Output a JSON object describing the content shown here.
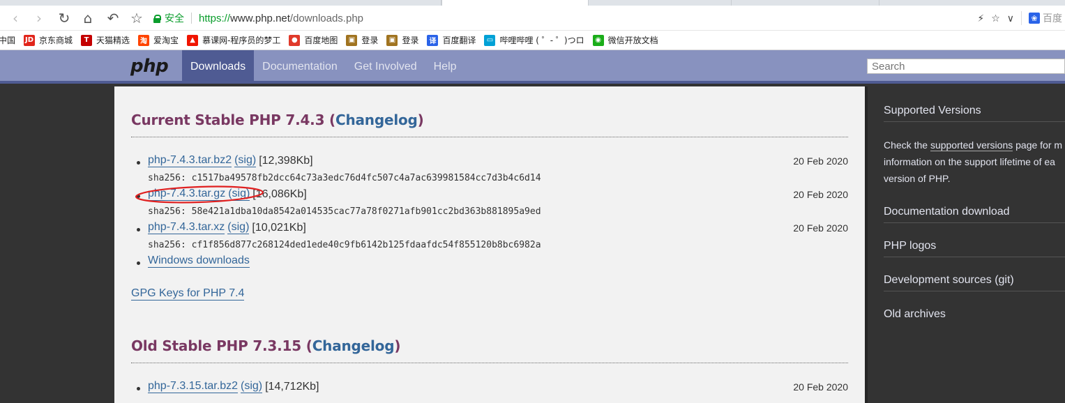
{
  "browser": {
    "secure_label": "安全",
    "url_scheme": "https://",
    "url_host": "www.php.net",
    "url_path": "/downloads.php",
    "search_engine_label": "百度"
  },
  "bookmarks": [
    {
      "label": "中国",
      "icon": "globe-icon",
      "color": "#ffffff"
    },
    {
      "label": "京东商城",
      "icon": "jd-icon",
      "color": "#e1251b"
    },
    {
      "label": "天猫精选",
      "icon": "tmall-icon",
      "color": "#c40000"
    },
    {
      "label": "爱淘宝",
      "icon": "taobao-icon",
      "color": "#ff4400"
    },
    {
      "label": "慕课网-程序员的梦工",
      "icon": "flame-icon",
      "color": "#f01400"
    },
    {
      "label": "百度地图",
      "icon": "map-pin-icon",
      "color": "#e03a2b"
    },
    {
      "label": "登录",
      "icon": "login-icon",
      "color": "#a0731f"
    },
    {
      "label": "登录",
      "icon": "login-icon",
      "color": "#a0731f"
    },
    {
      "label": "百度翻译",
      "icon": "translate-icon",
      "color": "#2a63e8"
    },
    {
      "label": "哔哩哔哩 ( ゜- ゜)つロ",
      "icon": "bilibili-icon",
      "color": "#00a1d6"
    },
    {
      "label": "微信开放文档",
      "icon": "wechat-icon",
      "color": "#1aad19"
    }
  ],
  "site": {
    "logo": "php",
    "nav": [
      "Downloads",
      "Documentation",
      "Get Involved",
      "Help"
    ],
    "search_placeholder": "Search"
  },
  "current": {
    "heading_prefix": "Current Stable PHP 7.4.3 (",
    "changelog": "Changelog",
    "heading_suffix": ")",
    "releases": [
      {
        "file": "php-7.4.3.tar.bz2",
        "sig": "(sig)",
        "size": "[12,398Kb]",
        "date": "20 Feb 2020",
        "sha": "sha256: c1517ba49578fb2dcc64c73a3edc76d4fc507c4a7ac639981584cc7d3b4c6d14"
      },
      {
        "file": "php-7.4.3.tar.gz",
        "sig": "(sig)",
        "size": "[16,086Kb]",
        "date": "20 Feb 2020",
        "sha": "sha256: 58e421a1dba10da8542a014535cac77a78f0271afb901cc2bd363b881895a9ed"
      },
      {
        "file": "php-7.4.3.tar.xz",
        "sig": "(sig)",
        "size": "[10,021Kb]",
        "date": "20 Feb 2020",
        "sha": "sha256: cf1f856d877c268124ded1ede40c9fb6142b125fdaafdc54f855120b8bc6982a"
      }
    ],
    "windows": "Windows downloads",
    "gpg": "GPG Keys for PHP 7.4"
  },
  "old": {
    "heading_prefix": "Old Stable PHP 7.3.15 (",
    "changelog": "Changelog",
    "heading_suffix": ")",
    "releases": [
      {
        "file": "php-7.3.15.tar.bz2",
        "sig": "(sig)",
        "size": "[14,712Kb]",
        "date": "20 Feb 2020"
      }
    ]
  },
  "sidebar": {
    "supported_title": "Supported Versions",
    "supported_text_1": "Check the ",
    "supported_link": "supported versions",
    "supported_text_2": " page for m",
    "supported_text_3": "information on the support lifetime of ea",
    "supported_text_4": "version of PHP.",
    "links": [
      "Documentation download",
      "PHP logos",
      "Development sources (git)",
      "Old archives"
    ]
  }
}
